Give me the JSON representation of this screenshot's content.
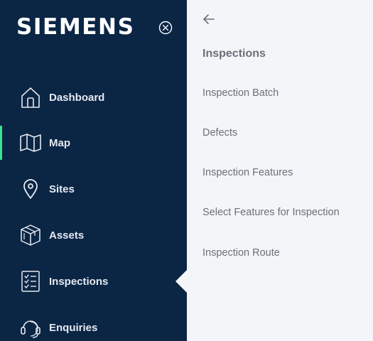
{
  "brand": {
    "logo_text": "SIEMENS",
    "colors": {
      "sidebar_bg": "#0b2545",
      "panel_bg": "#f4f5f9",
      "active_indicator": "#3ee08a",
      "nav_text": "#e6eaf0",
      "panel_text": "#6a6f7a"
    }
  },
  "sidebar": {
    "close_icon": "close-circle-icon",
    "active_item": "Map",
    "items": [
      {
        "label": "Dashboard",
        "icon": "home-icon"
      },
      {
        "label": "Map",
        "icon": "map-icon"
      },
      {
        "label": "Sites",
        "icon": "location-pin-icon"
      },
      {
        "label": "Assets",
        "icon": "cube-icon"
      },
      {
        "label": "Inspections",
        "icon": "checklist-icon"
      },
      {
        "label": "Enquiries",
        "icon": "headset-icon"
      }
    ]
  },
  "panel": {
    "back_icon": "arrow-left-icon",
    "title": "Inspections",
    "items": [
      {
        "label": "Inspection Batch"
      },
      {
        "label": "Defects"
      },
      {
        "label": "Inspection Features"
      },
      {
        "label": "Select Features for Inspection"
      },
      {
        "label": "Inspection Route"
      }
    ]
  }
}
